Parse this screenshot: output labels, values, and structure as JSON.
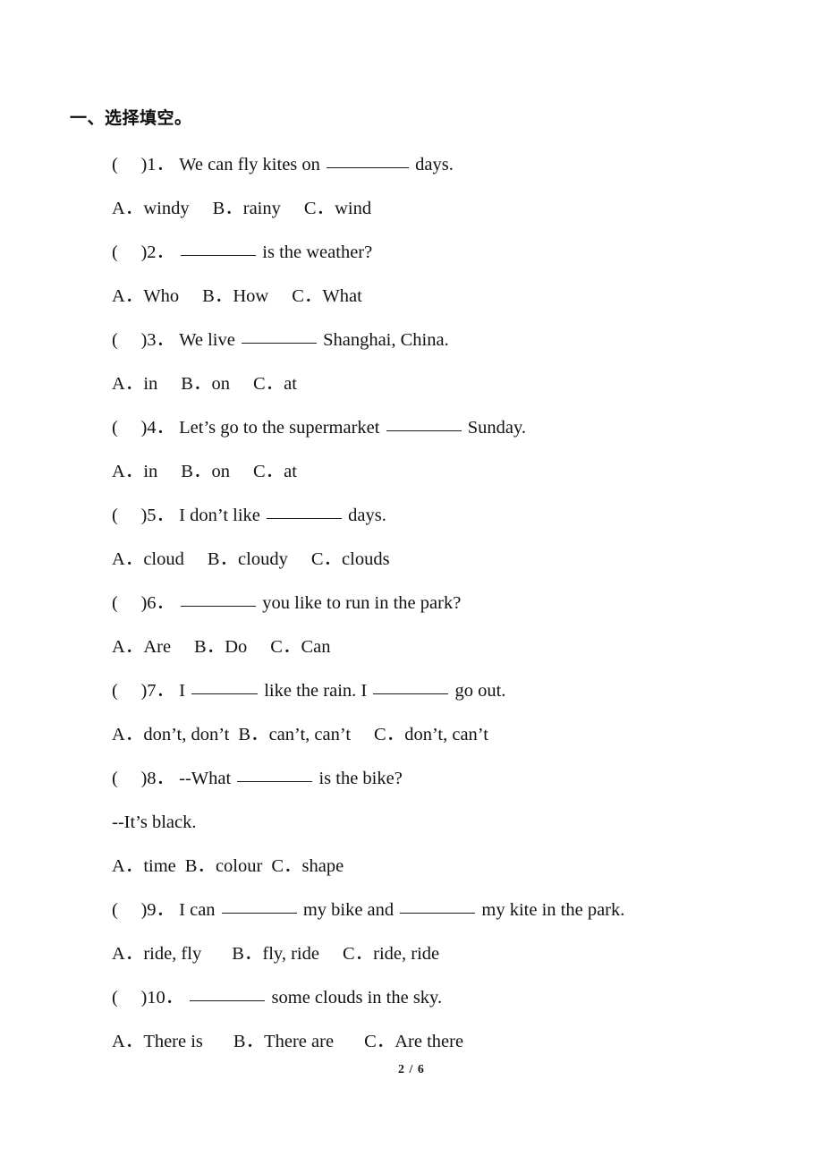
{
  "document": {
    "section_heading": "一、选择填空。",
    "footer": "2 / 6"
  },
  "questions": [
    {
      "marker_open": "(",
      "marker_close": ")",
      "number": "1．",
      "stem_before": "We can fly kites on ",
      "stem_after": " days.",
      "options_line": "A．windy     B．rainy     C．wind",
      "opt_a_label": "A．",
      "opt_a_text": "windy",
      "opt_b_label": "B．",
      "opt_b_text": "rainy",
      "opt_c_label": "C．",
      "opt_c_text": "wind"
    },
    {
      "marker_open": "(",
      "marker_close": ")",
      "number": "2．",
      "stem_before": "",
      "stem_after": " is the weather?",
      "options_line": "A．Who     B．How     C．What",
      "opt_a_label": "A．",
      "opt_a_text": "Who",
      "opt_b_label": "B．",
      "opt_b_text": "How",
      "opt_c_label": "C．",
      "opt_c_text": "What"
    },
    {
      "marker_open": "(",
      "marker_close": ")",
      "number": "3．",
      "stem_before": "We live ",
      "stem_after": " Shanghai, China.",
      "options_line": "A．in     B．on     C．at",
      "opt_a_label": "A．",
      "opt_a_text": "in",
      "opt_b_label": "B．",
      "opt_b_text": "on",
      "opt_c_label": "C．",
      "opt_c_text": "at"
    },
    {
      "marker_open": "(",
      "marker_close": ")",
      "number": "4．",
      "stem_before": "Let’s go to the supermarket ",
      "stem_after": " Sunday.",
      "options_line": "A．in     B．on     C．at",
      "opt_a_label": "A．",
      "opt_a_text": "in",
      "opt_b_label": "B．",
      "opt_b_text": "on",
      "opt_c_label": "C．",
      "opt_c_text": "at"
    },
    {
      "marker_open": "(",
      "marker_close": ")",
      "number": "5．",
      "stem_before": "I don’t like ",
      "stem_after": " days.",
      "options_line": "A．cloud     B．cloudy     C．clouds",
      "opt_a_label": "A．",
      "opt_a_text": "cloud",
      "opt_b_label": "B．",
      "opt_b_text": "cloudy",
      "opt_c_label": "C．",
      "opt_c_text": "clouds"
    },
    {
      "marker_open": "(",
      "marker_close": ")",
      "number": "6．",
      "stem_before": "",
      "stem_after": " you like to run in the park?",
      "options_line": "A．Are     B．Do     C．Can",
      "opt_a_label": "A．",
      "opt_a_text": "Are",
      "opt_b_label": "B．",
      "opt_b_text": "Do",
      "opt_c_label": "C．",
      "opt_c_text": "Can"
    },
    {
      "marker_open": "(",
      "marker_close": ")",
      "number": "7．",
      "stem_before": "I ",
      "stem_middle": " like the rain. I ",
      "stem_after": " go out.",
      "options_line": "A．don’t, don’t B．can’t, can’t   C．don’t, can’t",
      "opt_a_label": "A．",
      "opt_a_text": "don’t, don’t",
      "opt_b_label": "B．",
      "opt_b_text": "can’t, can’t",
      "opt_c_label": "C．",
      "opt_c_text": "don’t, can’t"
    },
    {
      "marker_open": "(",
      "marker_close": ")",
      "number": "8．",
      "stem_before": "--What ",
      "stem_after": " is the bike?",
      "reply": "--It’s black.",
      "options_line": "A．time B．colour C．shape",
      "opt_a_label": "A．",
      "opt_a_text": "time",
      "opt_b_label": "B．",
      "opt_b_text": "colour",
      "opt_c_label": "C．",
      "opt_c_text": "shape"
    },
    {
      "marker_open": "(",
      "marker_close": ")",
      "number": "9．",
      "stem_before": "I can ",
      "stem_middle": " my bike and ",
      "stem_after": " my kite in the park.",
      "options_line": "A．ride, fly     B．fly, ride     C．ride, ride",
      "opt_a_label": "A．",
      "opt_a_text": "ride, fly",
      "opt_b_label": "B．",
      "opt_b_text": "fly, ride",
      "opt_c_label": "C．",
      "opt_c_text": "ride, ride"
    },
    {
      "marker_open": "(",
      "marker_close": ")",
      "number": "10．",
      "stem_before": "",
      "stem_after": " some clouds in the sky.",
      "options_line": "A．There is     B．There are     C．Are there",
      "opt_a_label": "A．",
      "opt_a_text": "There is",
      "opt_b_label": "B．",
      "opt_b_text": "There are",
      "opt_c_label": "C．",
      "opt_c_text": "Are there"
    }
  ]
}
